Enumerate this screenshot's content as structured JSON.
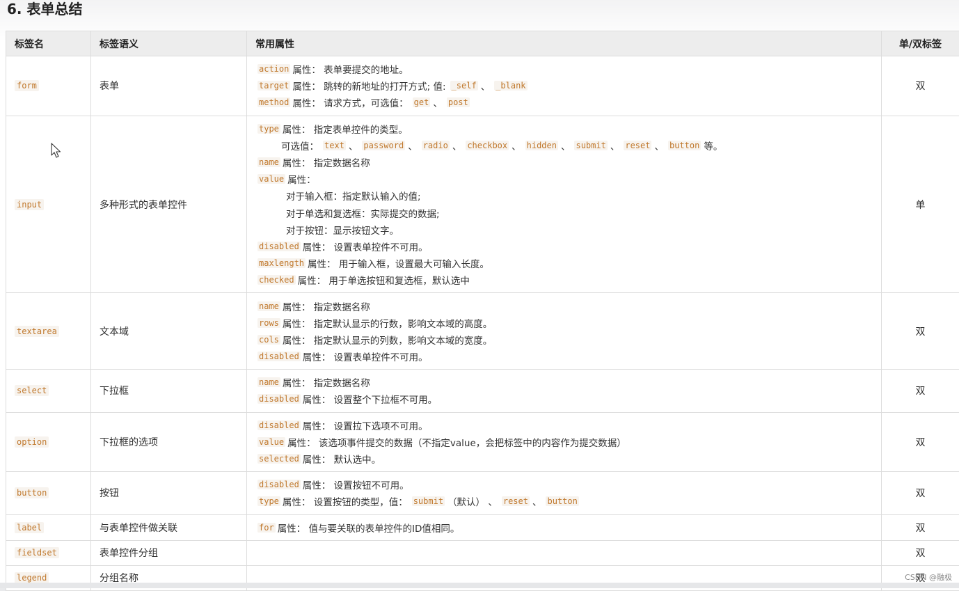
{
  "heading": "6. 表单总结",
  "columns": [
    "标签名",
    "标签语义",
    "常用属性",
    "单/双标签"
  ],
  "rows": [
    {
      "tag": "form",
      "semantic": "表单",
      "type": "双",
      "lines": [
        [
          {
            "c": "action"
          },
          {
            "t": " 属性：  表单要提交的地址。"
          }
        ],
        [
          {
            "c": "target"
          },
          {
            "t": " 属性：  跳转的新地址的打开方式; 值: "
          },
          {
            "c": "_self"
          },
          {
            "t": " 、 "
          },
          {
            "c": "_blank"
          }
        ],
        [
          {
            "c": "method"
          },
          {
            "t": " 属性：  请求方式，可选值： "
          },
          {
            "c": "get"
          },
          {
            "t": " 、 "
          },
          {
            "c": "post"
          }
        ]
      ]
    },
    {
      "tag": "input",
      "semantic": "多种形式的表单控件",
      "type": "单",
      "lines": [
        [
          {
            "c": "type"
          },
          {
            "t": " 属性：  指定表单控件的类型。"
          }
        ],
        [
          {
            "i": 1
          },
          {
            "t": "可选值： "
          },
          {
            "c": "text"
          },
          {
            "t": " 、 "
          },
          {
            "c": "password"
          },
          {
            "t": " 、 "
          },
          {
            "c": "radio"
          },
          {
            "t": " 、 "
          },
          {
            "c": "checkbox"
          },
          {
            "t": " 、 "
          },
          {
            "c": "hidden"
          },
          {
            "t": " 、 "
          },
          {
            "c": "submit"
          },
          {
            "t": " 、 "
          },
          {
            "c": "reset"
          },
          {
            "t": " 、 "
          },
          {
            "c": "button"
          },
          {
            "t": " 等。"
          }
        ],
        [
          {
            "c": "name"
          },
          {
            "t": " 属性：  指定数据名称"
          }
        ],
        [
          {
            "c": "value"
          },
          {
            "t": " 属性："
          }
        ],
        [
          {
            "i": 2
          },
          {
            "t": "对于输入框：指定默认输入的值;"
          }
        ],
        [
          {
            "i": 2
          },
          {
            "t": "对于单选和复选框：实际提交的数据;"
          }
        ],
        [
          {
            "i": 2
          },
          {
            "t": "对于按钮：显示按钮文字。"
          }
        ],
        [
          {
            "c": "disabled"
          },
          {
            "t": " 属性：  设置表单控件不可用。"
          }
        ],
        [
          {
            "c": "maxlength"
          },
          {
            "t": " 属性：  用于输入框，设置最大可输入长度。"
          }
        ],
        [
          {
            "c": "checked"
          },
          {
            "t": " 属性：  用于单选按钮和复选框，默认选中"
          }
        ]
      ]
    },
    {
      "tag": "textarea",
      "semantic": "文本域",
      "type": "双",
      "lines": [
        [
          {
            "c": "name"
          },
          {
            "t": " 属性：  指定数据名称"
          }
        ],
        [
          {
            "c": "rows"
          },
          {
            "t": " 属性：  指定默认显示的行数，影响文本域的高度。"
          }
        ],
        [
          {
            "c": "cols"
          },
          {
            "t": " 属性：  指定默认显示的列数，影响文本域的宽度。"
          }
        ],
        [
          {
            "c": "disabled"
          },
          {
            "t": " 属性：  设置表单控件不可用。"
          }
        ]
      ]
    },
    {
      "tag": "select",
      "semantic": "下拉框",
      "type": "双",
      "lines": [
        [
          {
            "c": "name"
          },
          {
            "t": " 属性：  指定数据名称"
          }
        ],
        [
          {
            "c": "disabled"
          },
          {
            "t": "属性：  设置整个下拉框不可用。"
          }
        ]
      ]
    },
    {
      "tag": "option",
      "semantic": "下拉框的选项",
      "type": "双",
      "lines": [
        [
          {
            "c": "disabled"
          },
          {
            "t": " 属性：  设置拉下选项不可用。"
          }
        ],
        [
          {
            "c": "value"
          },
          {
            "t": "属性：  该选项事件提交的数据（不指定value，会把标签中的内容作为提交数据）"
          }
        ],
        [
          {
            "c": "selected"
          },
          {
            "t": " 属性：  默认选中。"
          }
        ]
      ]
    },
    {
      "tag": "button",
      "semantic": "按钮",
      "type": "双",
      "lines": [
        [
          {
            "c": "disabled"
          },
          {
            "t": " 属性：  设置按钮不可用。"
          }
        ],
        [
          {
            "c": "type"
          },
          {
            "t": " 属性：  设置按钮的类型，值： "
          },
          {
            "c": "submit"
          },
          {
            "t": " （默认） 、 "
          },
          {
            "c": "reset"
          },
          {
            "t": " 、 "
          },
          {
            "c": "button"
          }
        ]
      ]
    },
    {
      "tag": "label",
      "semantic": "与表单控件做关联",
      "type": "双",
      "lines": [
        [
          {
            "c": "for"
          },
          {
            "t": " 属性：  值与要关联的表单控件的ID值相同。"
          }
        ]
      ]
    },
    {
      "tag": "fieldset",
      "semantic": "表单控件分组",
      "type": "双",
      "lines": []
    },
    {
      "tag": "legend",
      "semantic": "分组名称",
      "type": "双",
      "lines": []
    }
  ],
  "watermark": "CSDN @融极"
}
